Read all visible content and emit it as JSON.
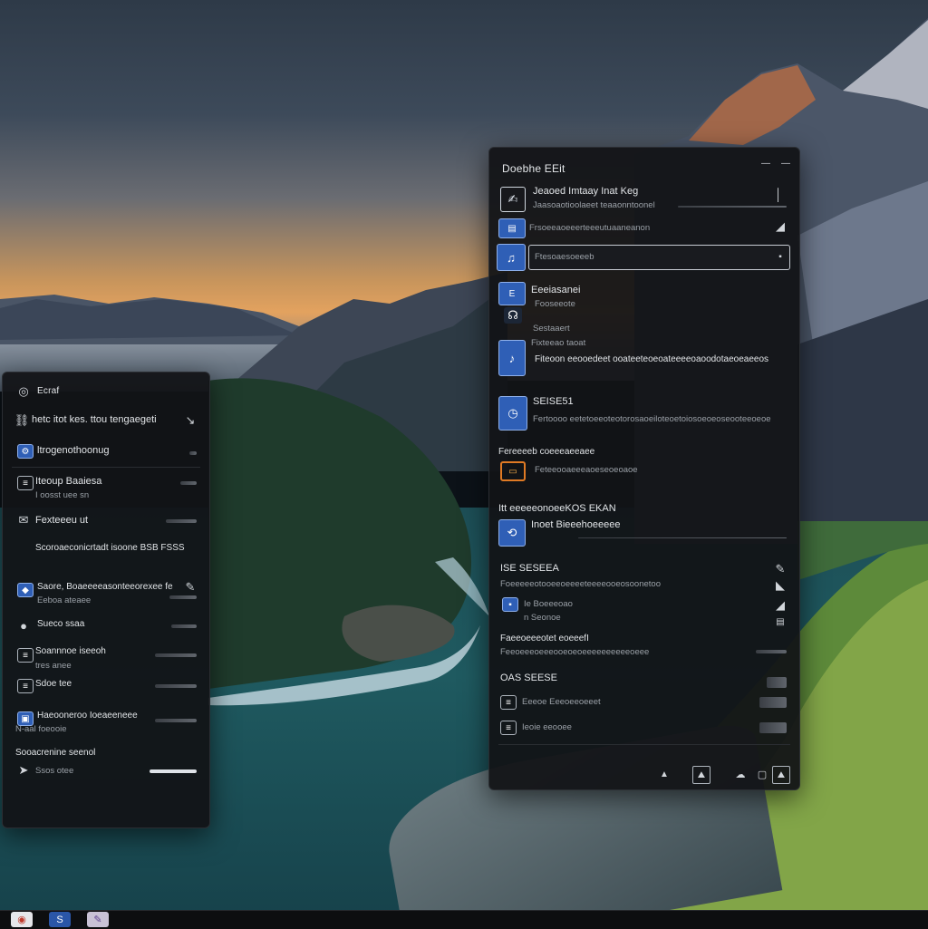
{
  "colors": {
    "accent": "#2f5fb6",
    "panel_bg": "#121316",
    "highlight_orange": "#e07a24"
  },
  "left_panel": {
    "title": "Ecraf",
    "header_text": "hetc itot kes. ttou tengaegeti",
    "items": [
      {
        "primary": "ltrogenothoonug",
        "secondary": "",
        "icon": "settings-icon"
      },
      {
        "primary": "Iteoup Baaiesa",
        "secondary": "I oosst uee sn",
        "icon": "list-icon"
      },
      {
        "primary": "Fexteeeu ut",
        "secondary": "",
        "icon": "mail-icon"
      },
      {
        "primary": "Scoroaeconicrtadt isoone BSB FSSS",
        "secondary": "",
        "icon": "none"
      },
      {
        "primary": "Saore, Boaeeeeasonteeorexee feaa",
        "secondary": "Eeboa ateaee",
        "icon": "app-icon"
      },
      {
        "primary": "Sueco ssaa",
        "secondary": "",
        "icon": "dot-icon"
      },
      {
        "primary": "Soannnoe iseeoh",
        "secondary": "tres anee",
        "icon": "list-icon"
      },
      {
        "primary": "Sdoe tee",
        "secondary": "",
        "icon": "list-icon"
      },
      {
        "primary": "Haeooneroo Ioeaeeneee",
        "secondary": "N-aal foeooie",
        "icon": "app-icon"
      },
      {
        "primary": "Sooacrenine seenol",
        "secondary": "Ssos otee",
        "icon": "send-icon"
      }
    ]
  },
  "right_panel": {
    "title": "Doebhe EEit",
    "items": [
      {
        "primary": "Jeaoed Imtaay Inat Keg",
        "secondary": "Jaasoaotioolaeet teaaonntoonel",
        "icon": "edit-icon"
      },
      {
        "primary": "Frsoeeaoeeerteeeutuaaneanon",
        "secondary": "",
        "icon": "app-icon"
      },
      {
        "primary": "Ftesoaesoeeeb",
        "secondary": "",
        "icon": "music-icon",
        "selected": true
      },
      {
        "primary": "Eeeiasanei",
        "secondary": "Fooseeote",
        "icon": "image-icon"
      },
      {
        "primary": "Sestaaert",
        "secondary": "",
        "icon": "music-icon"
      },
      {
        "primary": "Fixteeao taoat",
        "secondary": "Fiteoon eeooedeet ooateeteoeoateeeeoaoodotaeoeaeeos",
        "icon": "music-icon"
      },
      {
        "primary": "SEISE51",
        "secondary": "Fertoooo eetetoeeoteotorosaoeiloteoetoiosoeoeoseooteeoeoe",
        "icon": "clock-icon"
      },
      {
        "primary": "Fereeeeb coeeeaeeaee",
        "secondary": "Feteeooaeeeaoeseoeoaoe",
        "icon": "terminal-icon"
      },
      {
        "primary": "Itt eeeeeonoeeKOS EKAN",
        "secondary": "Inoet Bieeehoeeeee",
        "icon": "sync-icon"
      },
      {
        "primary": "ISE SESEEA",
        "secondary": "Foeeeeeotooeeoeeeeteeeeooeosoonetoo",
        "icon": "none"
      },
      {
        "primary": "Ie Boeeeoao",
        "secondary": "n Seonoe",
        "icon": "app-icon"
      },
      {
        "primary": "Faeeoeeeotet eoeeefI",
        "secondary": "Feeoeeeoeeeooeoeoeeeeeeeeeeoeee",
        "icon": "none"
      },
      {
        "primary": "OAS SEESE",
        "secondary": "",
        "icon": "none"
      },
      {
        "primary": "Eeeoe Eeeoeeoeeet",
        "secondary": "",
        "icon": "list-icon"
      },
      {
        "primary": "Ieoie eeooee",
        "secondary": "",
        "icon": "list-icon"
      }
    ]
  },
  "taskbar": [
    {
      "name": "browser-icon"
    },
    {
      "name": "app-icon"
    },
    {
      "name": "files-icon"
    }
  ]
}
